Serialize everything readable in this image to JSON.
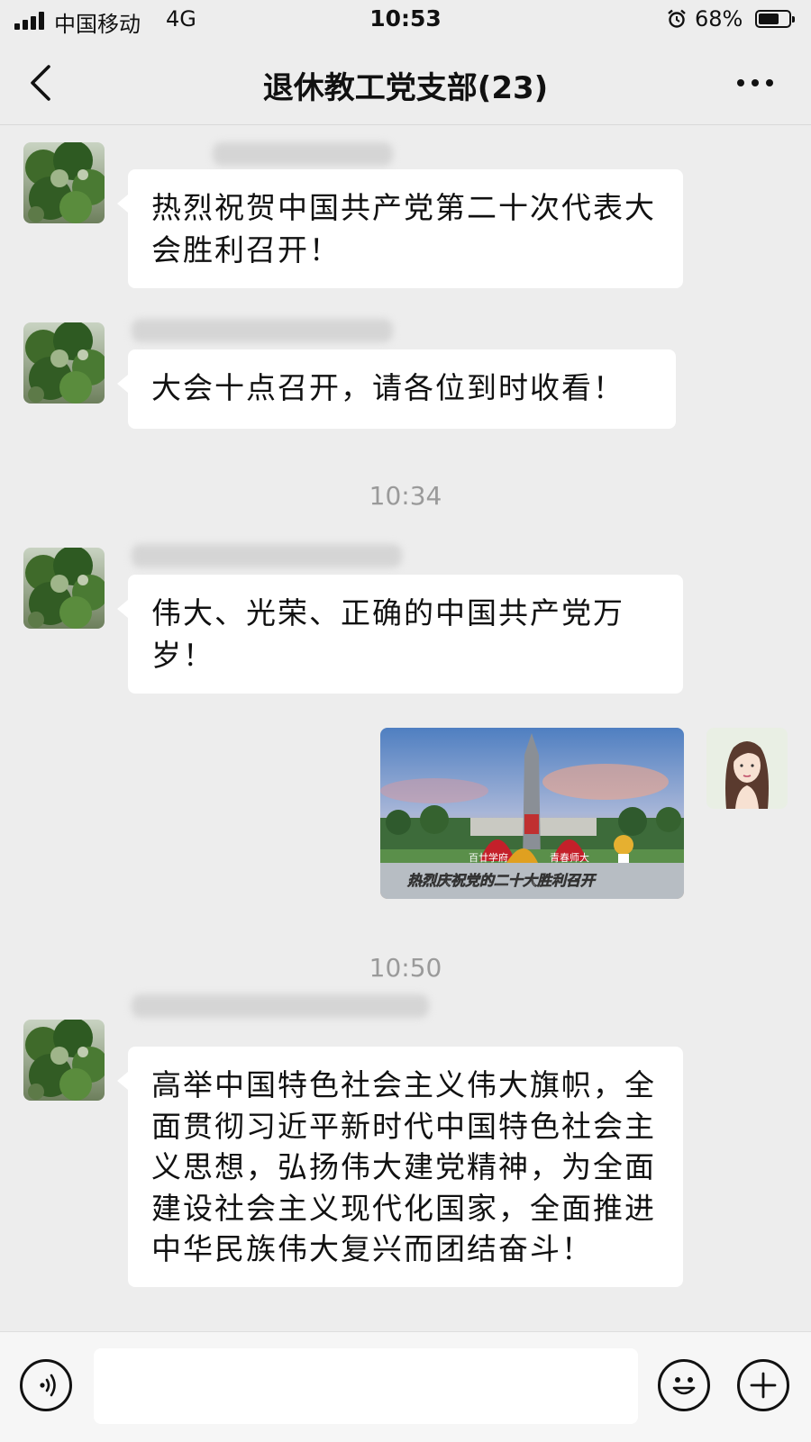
{
  "status_bar": {
    "carrier": "中国移动",
    "network": "4G",
    "time": "10:53",
    "battery_percent": "68%",
    "battery_level": 0.68
  },
  "nav": {
    "title": "退休教工党支部(23)",
    "back_icon": "chevron-left-icon",
    "more_icon": "more-dots-icon"
  },
  "messages": [
    {
      "text": "热烈祝贺中国共产党第二十次代表大会胜利召开！"
    },
    {
      "text": "大会十点召开，请各位到时收看！"
    },
    {
      "timestamp": "10:34"
    },
    {
      "text": "伟大、光荣、正确的中国共产党万岁！"
    },
    {
      "image": {
        "caption_left": "百廿学府",
        "caption_right": "青春师大",
        "banner": "热烈庆祝党的二十大胜利召开"
      }
    },
    {
      "timestamp": "10:50"
    },
    {
      "text": "高举中国特色社会主义伟大旗帜，全面贯彻习近平新时代中国特色社会主义思想，弘扬伟大建党精神，为全面建设社会主义现代化国家，全面推进中华民族伟大复兴而团结奋斗！"
    }
  ],
  "input_bar": {
    "placeholder": "",
    "voice_icon": "voice-icon",
    "emoji_icon": "emoji-icon",
    "plus_icon": "plus-icon"
  }
}
